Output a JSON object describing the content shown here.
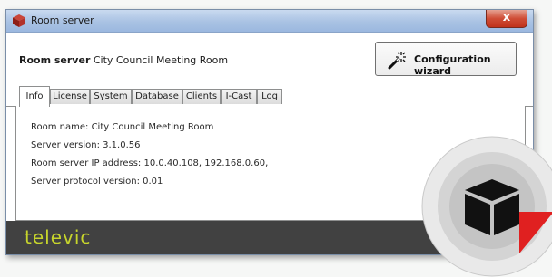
{
  "window": {
    "title": "Room server",
    "close_glyph": "x"
  },
  "header": {
    "title_bold": "Room server",
    "title_rest": "City Council Meeting Room",
    "wizard_label": "Configuration wizard",
    "wizard_icon": "magic-wand-icon"
  },
  "tabs": [
    {
      "label": "Info",
      "active": true
    },
    {
      "label": "License",
      "active": false
    },
    {
      "label": "System",
      "active": false
    },
    {
      "label": "Database",
      "active": false
    },
    {
      "label": "Clients",
      "active": false
    },
    {
      "label": "I-Cast",
      "active": false
    },
    {
      "label": "Log",
      "active": false
    }
  ],
  "info": {
    "room_name": "Room name: City Council Meeting Room",
    "server_version": "Server version: 3.1.0.56",
    "ip_addresses": "Room server IP address: 10.0.40.108, 192.168.0.60,",
    "protocol_version": "Server protocol version: 0.01"
  },
  "footer": {
    "brand": "televic"
  },
  "colors": {
    "brand_green": "#c7d52c",
    "footer_bg": "#414141",
    "badge_red": "#e02020",
    "close_red": "#c0321b"
  },
  "badge": {
    "icon": "cube-icon"
  }
}
